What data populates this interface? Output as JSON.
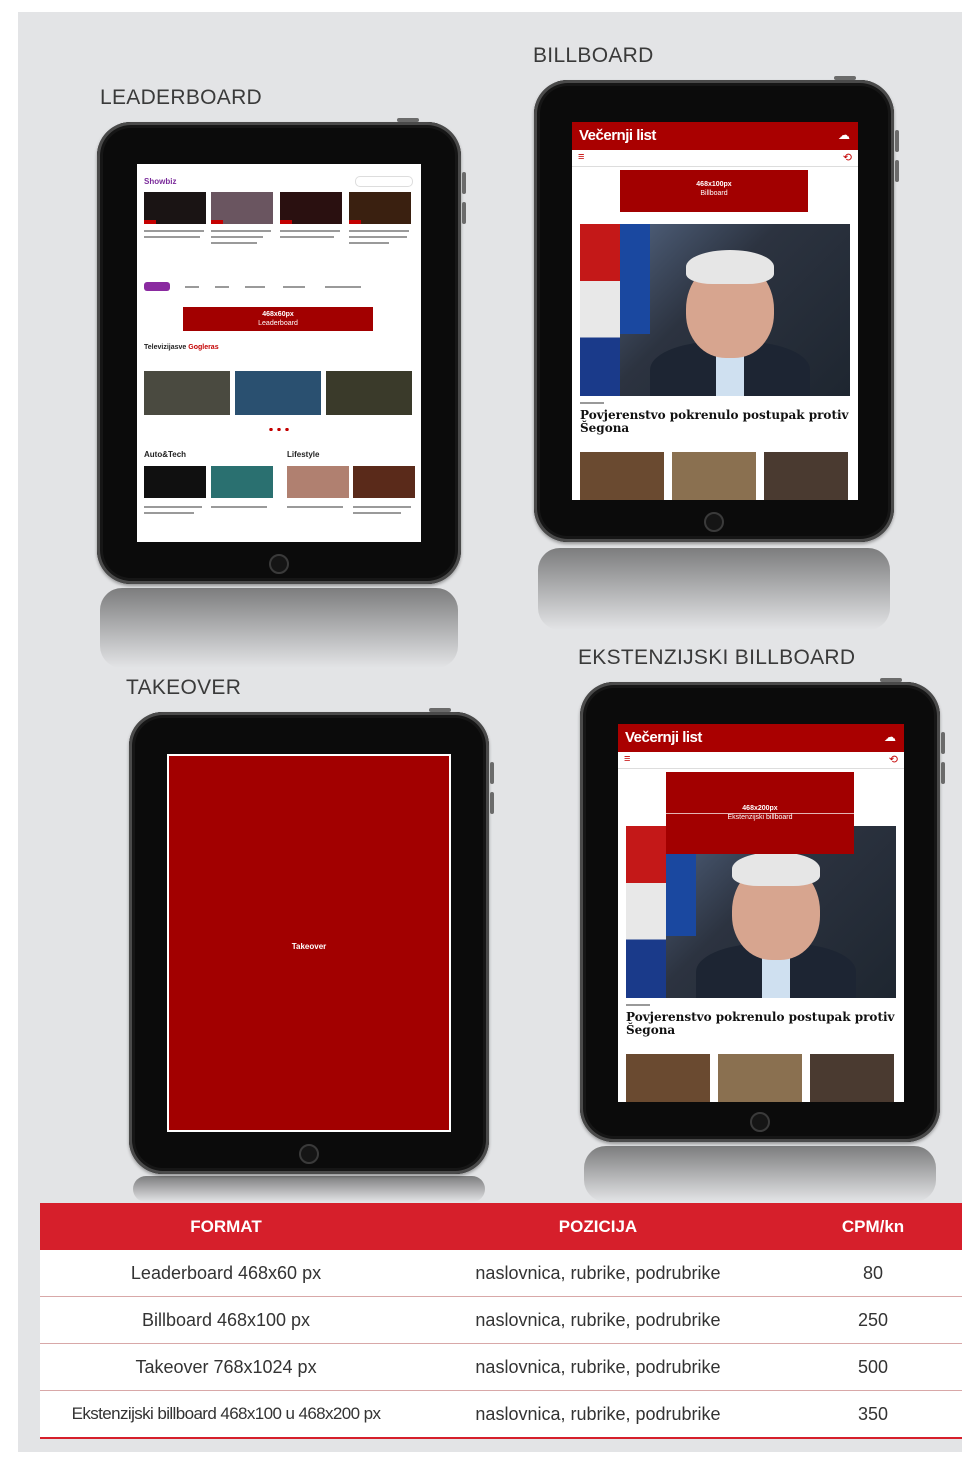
{
  "headings": {
    "leaderboard": "LEADERBOARD",
    "billboard": "BILLBOARD",
    "takeover": "TAKEOVER",
    "ekstenzijski": "EKSTENZIJSKI BILLBOARD"
  },
  "ads": {
    "leaderboard_size": "468x60px",
    "leaderboard_name": "Leaderboard",
    "billboard_size": "468x100px",
    "billboard_name": "Billboard",
    "takeover_name": "Takeover",
    "ekstenzijski_size": "468x200px",
    "ekstenzijski_name": "Ekstenzijski billboard"
  },
  "site": {
    "brand": "Večernji list",
    "headline": "Povjerenstvo pokrenulo postupak protiv Šegona"
  },
  "leaderboard_page": {
    "section1": "Showbiz",
    "section2": "Televizijasve",
    "section2_accent": "Gogleras",
    "section3": "Auto&Tech",
    "section4": "Lifestyle"
  },
  "table": {
    "headers": [
      "FORMAT",
      "POZICIJA",
      "CPM/kn"
    ],
    "rows": [
      {
        "format": "Leaderboard 468x60 px",
        "pozicija": "naslovnica, rubrike, podrubrike",
        "cpm": "80"
      },
      {
        "format": "Billboard 468x100 px",
        "pozicija": "naslovnica, rubrike, podrubrike",
        "cpm": "250"
      },
      {
        "format": "Takeover 768x1024 px",
        "pozicija": "naslovnica, rubrike, podrubrike",
        "cpm": "500"
      },
      {
        "format": "Ekstenzijski billboard 468x100 u 468x200 px",
        "pozicija": "naslovnica, rubrike, podrubrike",
        "cpm": "350"
      }
    ]
  },
  "colors": {
    "ad_red": "#a20000",
    "table_header_red": "#d61f2b",
    "background_gray": "#e3e4e6"
  }
}
